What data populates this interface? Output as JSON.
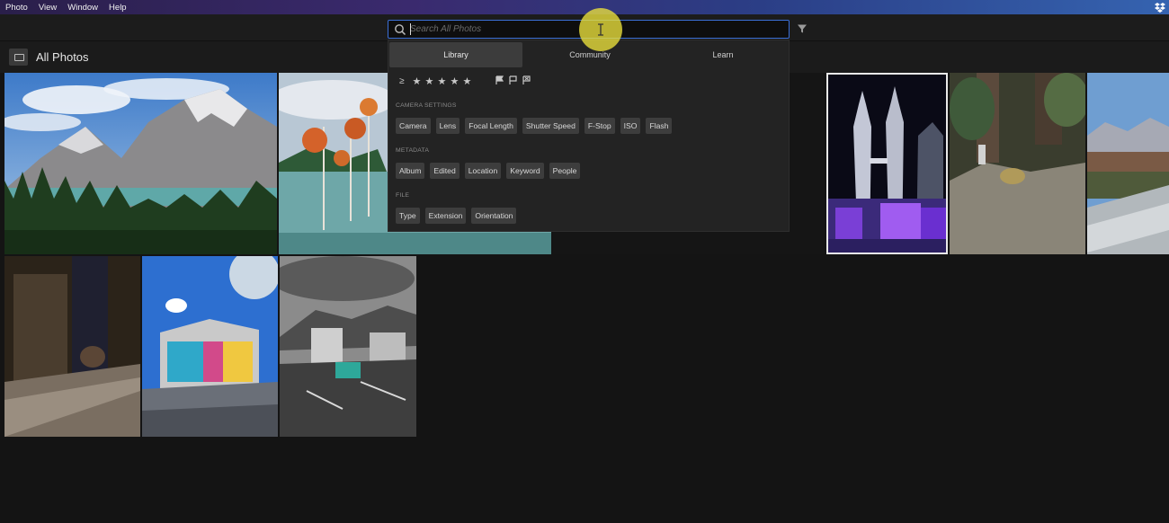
{
  "menubar": {
    "items": [
      "Photo",
      "View",
      "Window",
      "Help"
    ]
  },
  "search": {
    "placeholder": "Search All Photos",
    "value": ""
  },
  "header": {
    "title": "All Photos"
  },
  "dropdown": {
    "tabs": [
      {
        "label": "Library",
        "active": true
      },
      {
        "label": "Community",
        "active": false
      },
      {
        "label": "Learn",
        "active": false
      }
    ],
    "rating_operator": "≥",
    "stars": 5,
    "sections": [
      {
        "label": "CAMERA SETTINGS",
        "chips": [
          "Camera",
          "Lens",
          "Focal Length",
          "Shutter Speed",
          "F-Stop",
          "ISO",
          "Flash"
        ]
      },
      {
        "label": "METADATA",
        "chips": [
          "Album",
          "Edited",
          "Location",
          "Keyword",
          "People"
        ]
      },
      {
        "label": "FILE",
        "chips": [
          "Type",
          "Extension",
          "Orientation"
        ]
      }
    ]
  },
  "colors": {
    "accent_border": "#3b6fd6",
    "cursor_highlight": "#ece23c",
    "background": "#141414"
  },
  "photos": [
    {
      "name": "mountain-lake-photo",
      "selected": false
    },
    {
      "name": "autumn-trees-lake-photo",
      "selected": false
    },
    {
      "name": "night-dark-photo",
      "selected": false
    },
    {
      "name": "petronas-towers-photo",
      "selected": true
    },
    {
      "name": "iguana-rock-photo",
      "selected": false
    },
    {
      "name": "river-town-photo",
      "selected": false
    },
    {
      "name": "cat-table-photo",
      "selected": false
    },
    {
      "name": "mural-building-photo",
      "selected": false
    },
    {
      "name": "parking-jeep-photo",
      "selected": false
    }
  ]
}
